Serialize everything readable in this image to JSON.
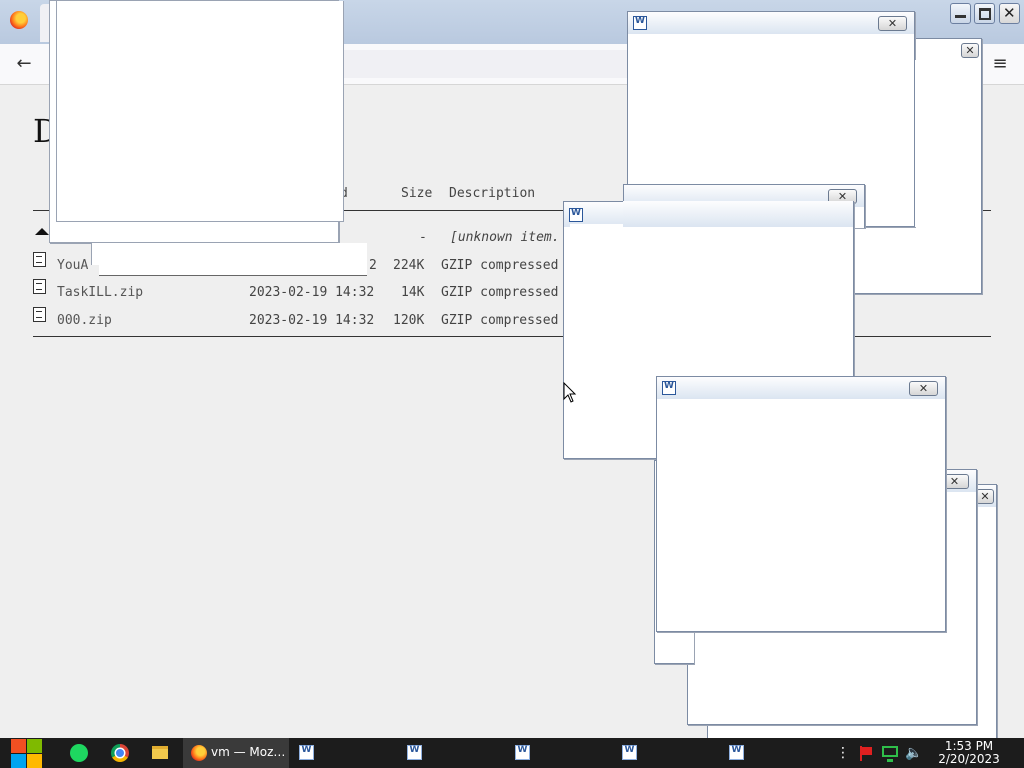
{
  "page": {
    "heading_fragment": "D",
    "columns": {
      "modified_fragment": "d",
      "size": "Size",
      "description": "Description"
    },
    "rows": [
      {
        "name": "",
        "date": "",
        "size": "-",
        "description": "[unknown item."
      },
      {
        "name": "YouA",
        "date_fragment": "2",
        "size": "224K",
        "description": "GZIP compressed"
      },
      {
        "name": "TaskILL.zip",
        "date": "2023-02-19 14:32",
        "size": "14K",
        "description": "GZIP compressed"
      },
      {
        "name": "000.zip",
        "date": "2023-02-19 14:32",
        "size": "120K",
        "description": "GZIP compressed"
      }
    ]
  },
  "taskbar": {
    "firefox_label": "vm — Moz…",
    "word_windows": 5
  },
  "clock": {
    "time": "1:53 PM",
    "date": "2/20/2023"
  },
  "window_buttons": {
    "close": "✕"
  }
}
